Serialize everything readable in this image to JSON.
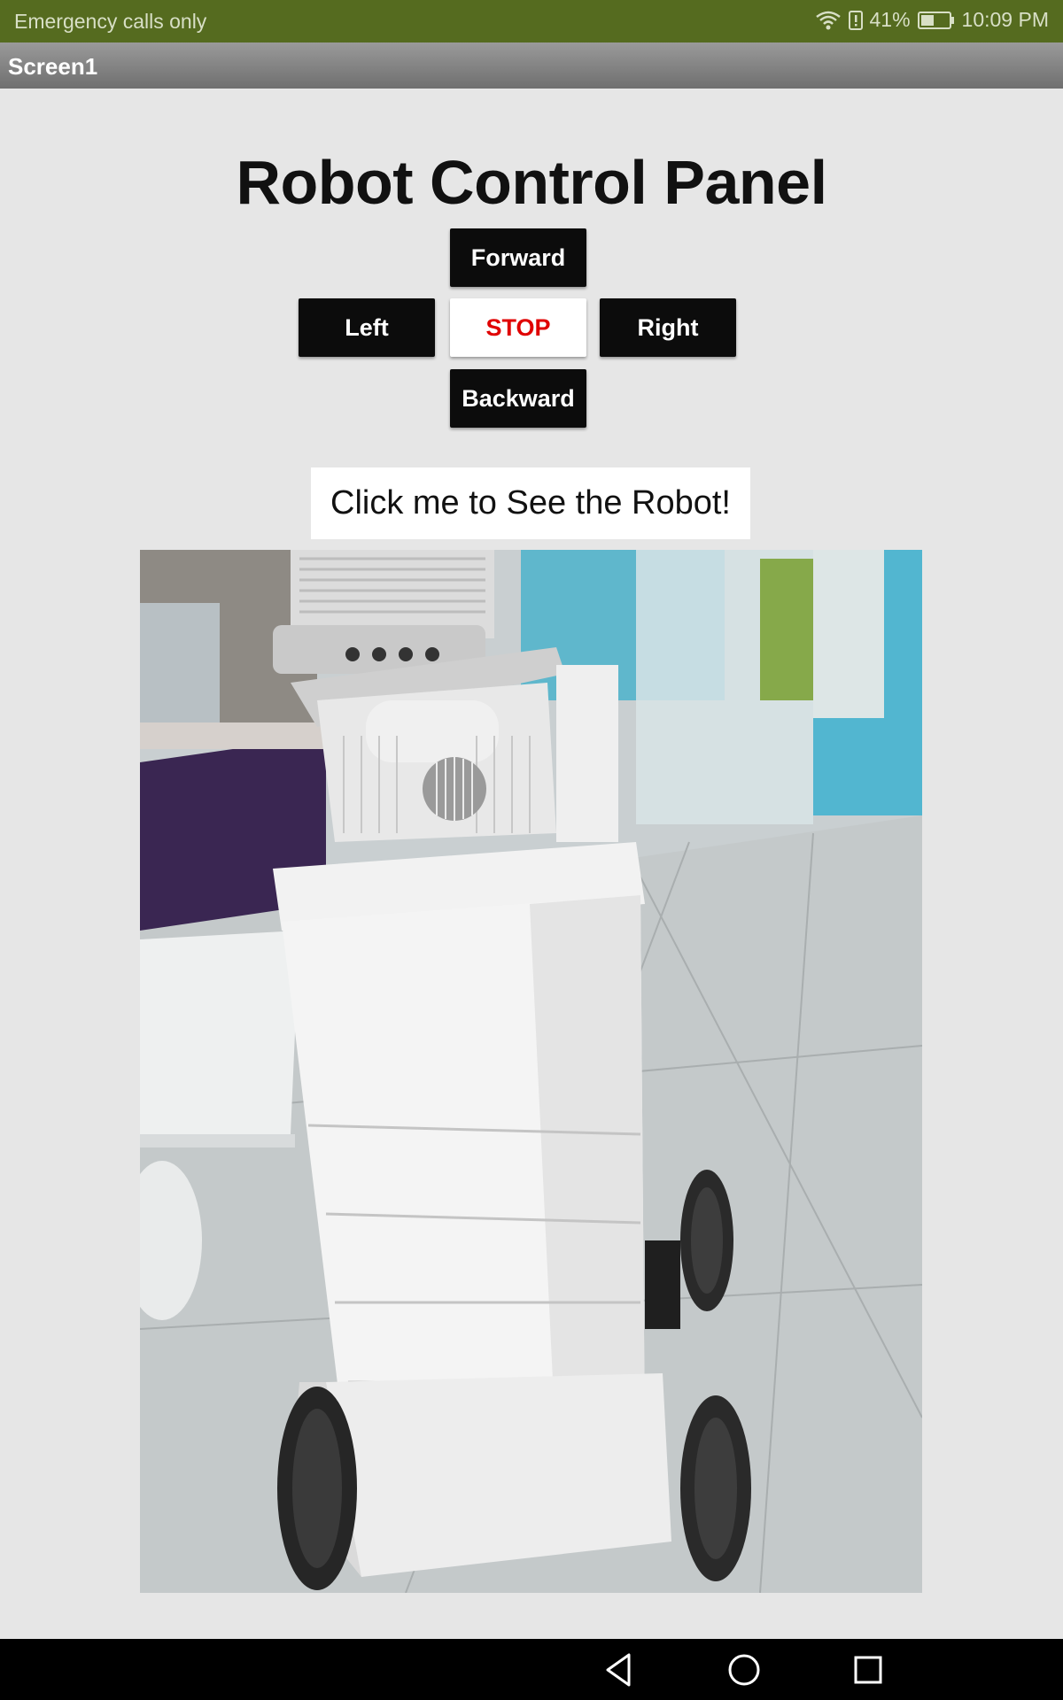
{
  "status_bar": {
    "carrier_text": "Emergency calls only",
    "battery_percent": "41%",
    "time": "10:09 PM",
    "color": "#556b1f"
  },
  "app_bar": {
    "title": "Screen1"
  },
  "panel": {
    "title": "Robot Control Panel",
    "buttons": {
      "forward": "Forward",
      "left": "Left",
      "stop": "STOP",
      "right": "Right",
      "backward": "Backward"
    },
    "see_robot_label": "Click me to See the Robot!",
    "stop_color": "#e00000"
  },
  "image": {
    "subject": "robot-photo"
  },
  "nav_bar": {
    "icons": [
      "back-icon",
      "home-icon",
      "recents-icon"
    ]
  }
}
